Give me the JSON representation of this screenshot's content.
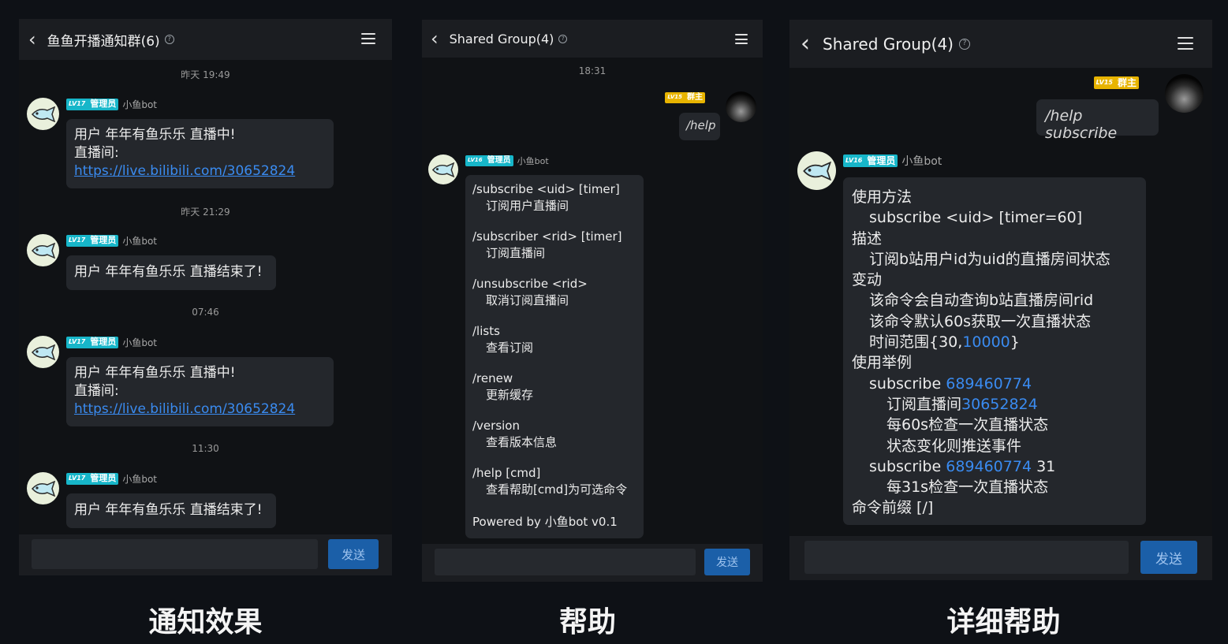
{
  "panel1": {
    "title": "鱼鱼开播通知群(6)",
    "messages": [
      {
        "time": "昨天 19:49",
        "level": "LV17",
        "role": "管理员",
        "name": "小鱼bot",
        "line1": "用户 年年有鱼乐乐 直播中!",
        "line2": "直播间:",
        "link": "https://live.bilibili.com/30652824"
      },
      {
        "time": "昨天 21:29",
        "level": "LV17",
        "role": "管理员",
        "name": "小鱼bot",
        "line1": "用户 年年有鱼乐乐 直播结束了!"
      },
      {
        "time": "07:46",
        "level": "LV17",
        "role": "管理员",
        "name": "小鱼bot",
        "line1": "用户 年年有鱼乐乐 直播中!",
        "line2": "直播间:",
        "link": "https://live.bilibili.com/30652824"
      },
      {
        "time": "11:30",
        "level": "LV17",
        "role": "管理员",
        "name": "小鱼bot",
        "line1": "用户 年年有鱼乐乐 直播结束了!"
      }
    ],
    "send_label": "发送",
    "caption": "通知效果"
  },
  "panel2": {
    "title": "Shared Group(4)",
    "time": "18:31",
    "owner_level": "LV15",
    "owner_role": "群主",
    "user_msg": "/help",
    "bot_level": "LV16",
    "bot_role": "管理员",
    "bot_name": "小鱼bot",
    "help_lines": [
      {
        "cmd": "/subscribe <uid> [timer]",
        "desc": "订阅用户直播间"
      },
      {
        "cmd": "/subscriber <rid> [timer]",
        "desc": "订阅直播间"
      },
      {
        "cmd": "/unsubscribe <rid>",
        "desc": "取消订阅直播间"
      },
      {
        "cmd": "/lists",
        "desc": "查看订阅"
      },
      {
        "cmd": "/renew",
        "desc": "更新缓存"
      },
      {
        "cmd": "/version",
        "desc": "查看版本信息"
      },
      {
        "cmd": "/help [cmd]",
        "desc": "查看帮助[cmd]为可选命令"
      }
    ],
    "powered": "Powered by 小鱼bot v0.1",
    "send_label": "发送",
    "caption": "帮助"
  },
  "panel3": {
    "title": "Shared Group(4)",
    "owner_level": "LV15",
    "owner_role": "群主",
    "user_msg": "/help subscribe",
    "bot_level": "LV16",
    "bot_role": "管理员",
    "bot_name": "小鱼bot",
    "l1": "使用方法",
    "l2": "subscribe <uid> [timer=60]",
    "l3": "描述",
    "l4": "订阅b站用户id为uid的直播房间状态",
    "l5": "变动",
    "l6": "该命令会自动查询b站直播房间rid",
    "l7": "该命令默认60s获取一次直播状态",
    "l8_pre": "时间范围{30,",
    "l8_link": "10000",
    "l8_post": "}",
    "l9": "使用举例",
    "l10_pre": "subscribe ",
    "l10_link": "689460774",
    "l11_pre": "订阅直播间",
    "l11_link": "30652824",
    "l12": "每60s检查一次直播状态",
    "l13": "状态变化则推送事件",
    "l14_pre": "subscribe ",
    "l14_link": "689460774",
    "l14_post": " 31",
    "l15": "每31s检查一次直播状态",
    "l16": "命令前缀 [/]",
    "send_label": "发送",
    "caption": "详细帮助"
  }
}
